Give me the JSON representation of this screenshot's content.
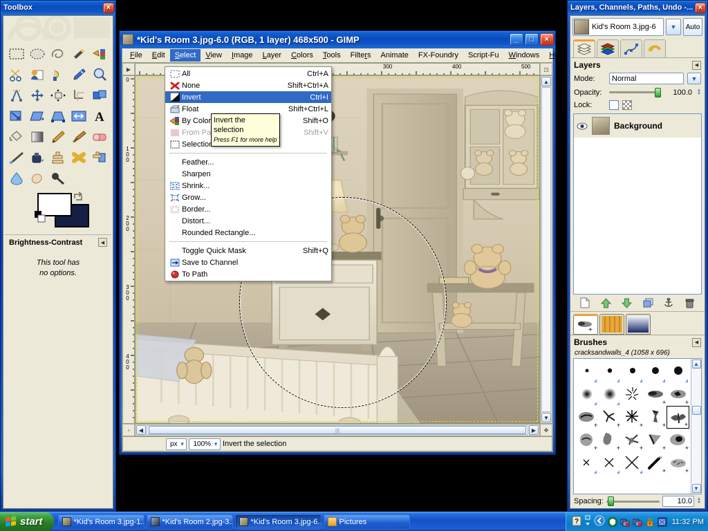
{
  "toolbox": {
    "title": "Toolbox",
    "close_label": "×",
    "tools": [
      "rect-select-tool",
      "ellipse-select-tool",
      "free-select-tool",
      "fuzzy-select-tool",
      "by-color-select-tool",
      "scissors-select-tool",
      "foreground-select-tool",
      "paths-tool",
      "color-picker-tool",
      "zoom-tool",
      "measure-tool",
      "move-tool",
      "alignment-tool",
      "crop-tool",
      "rotate-tool",
      "scale-tool",
      "shear-tool",
      "perspective-tool",
      "flip-tool",
      "text-tool",
      "bucket-fill-tool",
      "blend-tool",
      "pencil-tool",
      "paintbrush-tool",
      "eraser-tool",
      "airbrush-tool",
      "ink-tool",
      "clone-tool",
      "heal-tool",
      "perspective-clone-tool",
      "blur-sharpen-tool",
      "smudge-tool",
      "dodge-burn-tool"
    ],
    "foreground_color": "#ffffff",
    "background_color": "#151f44",
    "options_title": "Brightness-Contrast",
    "options_text_line1": "This tool has",
    "options_text_line2": "no options."
  },
  "image_window": {
    "title": "*Kid's Room 3.jpg-6.0 (RGB, 1 layer) 468x500 - GIMP",
    "minimize_label": "_",
    "maximize_label": "□",
    "close_label": "×",
    "menus": [
      {
        "label": "File",
        "mnemonic": "F"
      },
      {
        "label": "Edit",
        "mnemonic": "E"
      },
      {
        "label": "Select",
        "mnemonic": "S"
      },
      {
        "label": "View",
        "mnemonic": "V"
      },
      {
        "label": "Image",
        "mnemonic": "I"
      },
      {
        "label": "Layer",
        "mnemonic": "L"
      },
      {
        "label": "Colors",
        "mnemonic": "C"
      },
      {
        "label": "Tools",
        "mnemonic": "T"
      },
      {
        "label": "Filters",
        "mnemonic": "r"
      },
      {
        "label": "Animate",
        "mnemonic": ""
      },
      {
        "label": "FX-Foundry",
        "mnemonic": ""
      },
      {
        "label": "Script-Fu",
        "mnemonic": ""
      },
      {
        "label": "Windows",
        "mnemonic": "W"
      },
      {
        "label": "Help",
        "mnemonic": "H"
      }
    ],
    "active_menu": "Select",
    "ruler_h_labels": [
      "300",
      "400",
      "500"
    ],
    "ruler_v_labels": [
      "0",
      "100",
      "200",
      "300",
      "400"
    ],
    "statusbar": {
      "unit": "px",
      "zoom": "100%",
      "message": "Invert the selection"
    }
  },
  "select_menu": {
    "items": [
      {
        "label": "All",
        "shortcut": "Ctrl+A",
        "icon": "select-all-icon",
        "state": "normal"
      },
      {
        "label": "None",
        "shortcut": "Shift+Ctrl+A",
        "icon": "select-none-icon",
        "state": "normal"
      },
      {
        "label": "Invert",
        "shortcut": "Ctrl+I",
        "icon": "select-invert-icon",
        "state": "highlighted"
      },
      {
        "label": "Float",
        "shortcut": "Shift+Ctrl+L",
        "icon": "select-float-icon",
        "state": "normal"
      },
      {
        "label": "By Color",
        "shortcut": "Shift+O",
        "icon": "select-by-color-icon",
        "state": "normal"
      },
      {
        "label": "From Path",
        "shortcut": "Shift+V",
        "icon": "select-from-path-icon",
        "state": "disabled"
      },
      {
        "label": "Selection Editor",
        "shortcut": "",
        "icon": "selection-editor-icon",
        "state": "normal"
      },
      {
        "separator": true
      },
      {
        "label": "Feather...",
        "shortcut": "",
        "icon": "",
        "state": "normal"
      },
      {
        "label": "Sharpen",
        "shortcut": "",
        "icon": "",
        "state": "normal"
      },
      {
        "label": "Shrink...",
        "shortcut": "",
        "icon": "shrink-icon",
        "state": "normal"
      },
      {
        "label": "Grow...",
        "shortcut": "",
        "icon": "grow-icon",
        "state": "normal"
      },
      {
        "label": "Border...",
        "shortcut": "",
        "icon": "border-icon",
        "state": "normal"
      },
      {
        "label": "Distort...",
        "shortcut": "",
        "icon": "",
        "state": "normal"
      },
      {
        "label": "Rounded Rectangle...",
        "shortcut": "",
        "icon": "",
        "state": "normal"
      },
      {
        "separator": true
      },
      {
        "label": "Toggle Quick Mask",
        "shortcut": "Shift+Q",
        "icon": "",
        "state": "normal"
      },
      {
        "label": "Save to Channel",
        "shortcut": "",
        "icon": "save-to-channel-icon",
        "state": "normal"
      },
      {
        "label": "To Path",
        "shortcut": "",
        "icon": "to-path-icon",
        "state": "normal"
      }
    ]
  },
  "tooltip": {
    "line1": "Invert the selection",
    "line2": "Press F1 for more help"
  },
  "dock": {
    "title": "Layers, Channels, Paths, Undo -...",
    "close_label": "×",
    "image_name": "Kid's Room 3.jpg-6",
    "auto_label": "Auto",
    "tabs": [
      "layers-tab",
      "channels-tab",
      "paths-tab",
      "undo-history-tab"
    ],
    "active_tab": "layers-tab",
    "layers": {
      "section_title": "Layers",
      "mode_label": "Mode:",
      "mode_value": "Normal",
      "opacity_label": "Opacity:",
      "opacity_value": "100.0",
      "lock_label": "Lock:",
      "rows": [
        {
          "name": "Background",
          "visible": true,
          "selected": true
        }
      ],
      "buttons": [
        "new-layer-button",
        "raise-layer-button",
        "lower-layer-button",
        "duplicate-layer-button",
        "anchor-layer-button",
        "delete-layer-button"
      ]
    },
    "lower_tabs": [
      "brushes-tab",
      "patterns-tab",
      "gradients-tab"
    ],
    "lower_active_tab": "brushes-tab",
    "brushes": {
      "section_title": "Brushes",
      "selected_brush": "cracksandwalls_4 (1058 x 696)",
      "spacing_label": "Spacing:",
      "spacing_value": "10.0"
    }
  },
  "taskbar": {
    "start_label": "start",
    "tasks": [
      {
        "label": "*Kid's Room 3.jpg-1....",
        "active": false
      },
      {
        "label": "*Kid's Room 2.jpg-3....",
        "active": false
      },
      {
        "label": "*Kid's Room 3.jpg-6....",
        "active": true
      },
      {
        "label": "Pictures",
        "active": false
      }
    ],
    "clock": "11:32 PM",
    "tray_icons": [
      "help-icon",
      "show-hidden-icon",
      "chevron-left-icon",
      "shield-icon",
      "network-error-icon",
      "network-error-2-icon",
      "security-alert-icon",
      "monitor-icon"
    ]
  },
  "colors": {
    "title_blue": "#0a4bbd",
    "panel_bg": "#ece9d8",
    "menu_highlight": "#316ac5",
    "tooltip_bg": "#ffffdc",
    "accent_orange": "#e8a33d"
  }
}
